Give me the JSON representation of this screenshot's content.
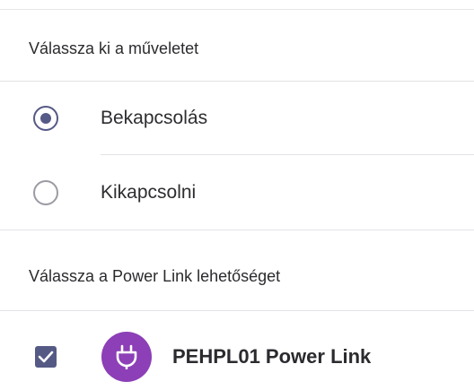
{
  "operation_section": {
    "title": "Válassza ki a műveletet",
    "options": [
      {
        "label": "Bekapcsolás",
        "selected": true
      },
      {
        "label": "Kikapcsolni",
        "selected": false
      }
    ]
  },
  "powerlink_section": {
    "title": "Válassza a Power Link lehetőséget",
    "devices": [
      {
        "label": "PEHPL01 Power Link",
        "checked": true,
        "icon": "plug-icon"
      }
    ]
  },
  "colors": {
    "accent": "#565a86",
    "device_icon_bg": "#8c3fb6"
  }
}
